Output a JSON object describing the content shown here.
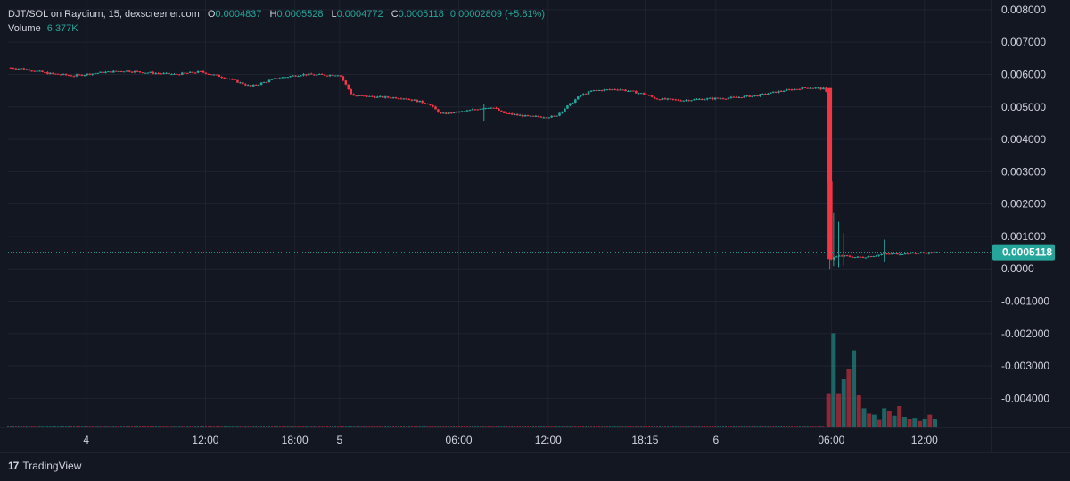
{
  "header": {
    "symbol": "DJT/SOL on Raydium, 15, dexscreener.com",
    "o_label": "O",
    "o_value": "0.0004837",
    "h_label": "H",
    "h_value": "0.0005528",
    "l_label": "L",
    "l_value": "0.0004772",
    "c_label": "C",
    "c_value": "0.0005118",
    "change": "0.00002809 (+5.81%)",
    "volume_label": "Volume",
    "volume_value": "6.377K"
  },
  "branding": {
    "logo": "17",
    "text": "TradingView"
  },
  "colors": {
    "background": "#131722",
    "up": "#26a69a",
    "down": "#f23645",
    "grid": "#1f2330",
    "text": "#d1d4dc"
  },
  "chart_data": {
    "type": "candlestick",
    "y_ticks": [
      "0.008000",
      "0.007000",
      "0.006000",
      "0.005000",
      "0.004000",
      "0.003000",
      "0.002000",
      "0.001000",
      "0.0000",
      "-0.001000",
      "-0.002000",
      "-0.003000",
      "-0.004000"
    ],
    "ylim": [
      -0.0049,
      0.0083
    ],
    "x_ticks": [
      "4",
      "12:00",
      "18:00",
      "5",
      "06:00",
      "12:00",
      "18:15",
      "6",
      "06:00",
      "12:00"
    ],
    "x_tick_pos": [
      0.0,
      0.4706,
      0.8235,
      1.0,
      1.4706,
      1.8235,
      2.2059,
      2.4853,
      2.9412,
      3.3088
    ],
    "xlim": [
      -0.3088,
      3.5735
    ],
    "last_price": "0.0005118",
    "last_price_value": 0.0005118,
    "price_path": {
      "t": [
        -0.31,
        -0.25,
        -0.15,
        -0.05,
        0.05,
        0.15,
        0.25,
        0.35,
        0.45,
        0.55,
        0.65,
        0.75,
        0.85,
        0.95,
        1.0,
        1.05,
        1.15,
        1.25,
        1.35,
        1.4,
        1.5,
        1.55,
        1.6,
        1.65,
        1.75,
        1.85,
        1.95,
        2.0,
        2.1,
        2.2,
        2.25,
        2.35,
        2.45,
        2.55,
        2.65,
        2.75,
        2.8,
        2.85,
        2.92,
        2.94,
        2.95,
        2.98,
        3.05,
        3.15,
        3.25,
        3.35,
        3.45
      ],
      "p": [
        0.00621,
        0.00618,
        0.00603,
        0.00596,
        0.00605,
        0.00611,
        0.00605,
        0.006,
        0.00608,
        0.0059,
        0.00563,
        0.00588,
        0.006,
        0.00598,
        0.006,
        0.00535,
        0.0053,
        0.00528,
        0.0051,
        0.00478,
        0.00487,
        0.00495,
        0.005,
        0.0048,
        0.0047,
        0.0047,
        0.00535,
        0.0055,
        0.00555,
        0.0054,
        0.00525,
        0.0052,
        0.00525,
        0.00528,
        0.00535,
        0.0055,
        0.00555,
        0.0056,
        0.00555,
        0.0003,
        0.00035,
        0.0004,
        0.00035,
        0.00045,
        0.00048,
        0.0005,
        0.00052
      ]
    },
    "wicks": [
      {
        "t": 1.57,
        "high": 0.00508,
        "low": 0.00455
      },
      {
        "t": 2.95,
        "high": 0.00172,
        "low": 8e-05
      },
      {
        "t": 2.97,
        "high": 0.00145,
        "low": 5e-05
      },
      {
        "t": 2.99,
        "high": 0.0011,
        "low": 0.0001
      },
      {
        "t": 3.15,
        "high": 0.0009,
        "low": 0.0002
      }
    ],
    "volume_path": {
      "t": [
        2.93,
        2.95,
        2.97,
        2.99,
        3.01,
        3.03,
        3.05,
        3.07,
        3.09,
        3.11,
        3.13,
        3.15,
        3.17,
        3.19,
        3.21,
        3.23,
        3.25,
        3.27,
        3.29,
        3.31,
        3.33,
        3.35
      ],
      "v": [
        0.32,
        0.88,
        0.32,
        0.45,
        0.55,
        0.72,
        0.3,
        0.18,
        0.13,
        0.12,
        0.07,
        0.18,
        0.15,
        0.11,
        0.2,
        0.1,
        0.08,
        0.09,
        0.06,
        0.08,
        0.12,
        0.08
      ]
    }
  }
}
